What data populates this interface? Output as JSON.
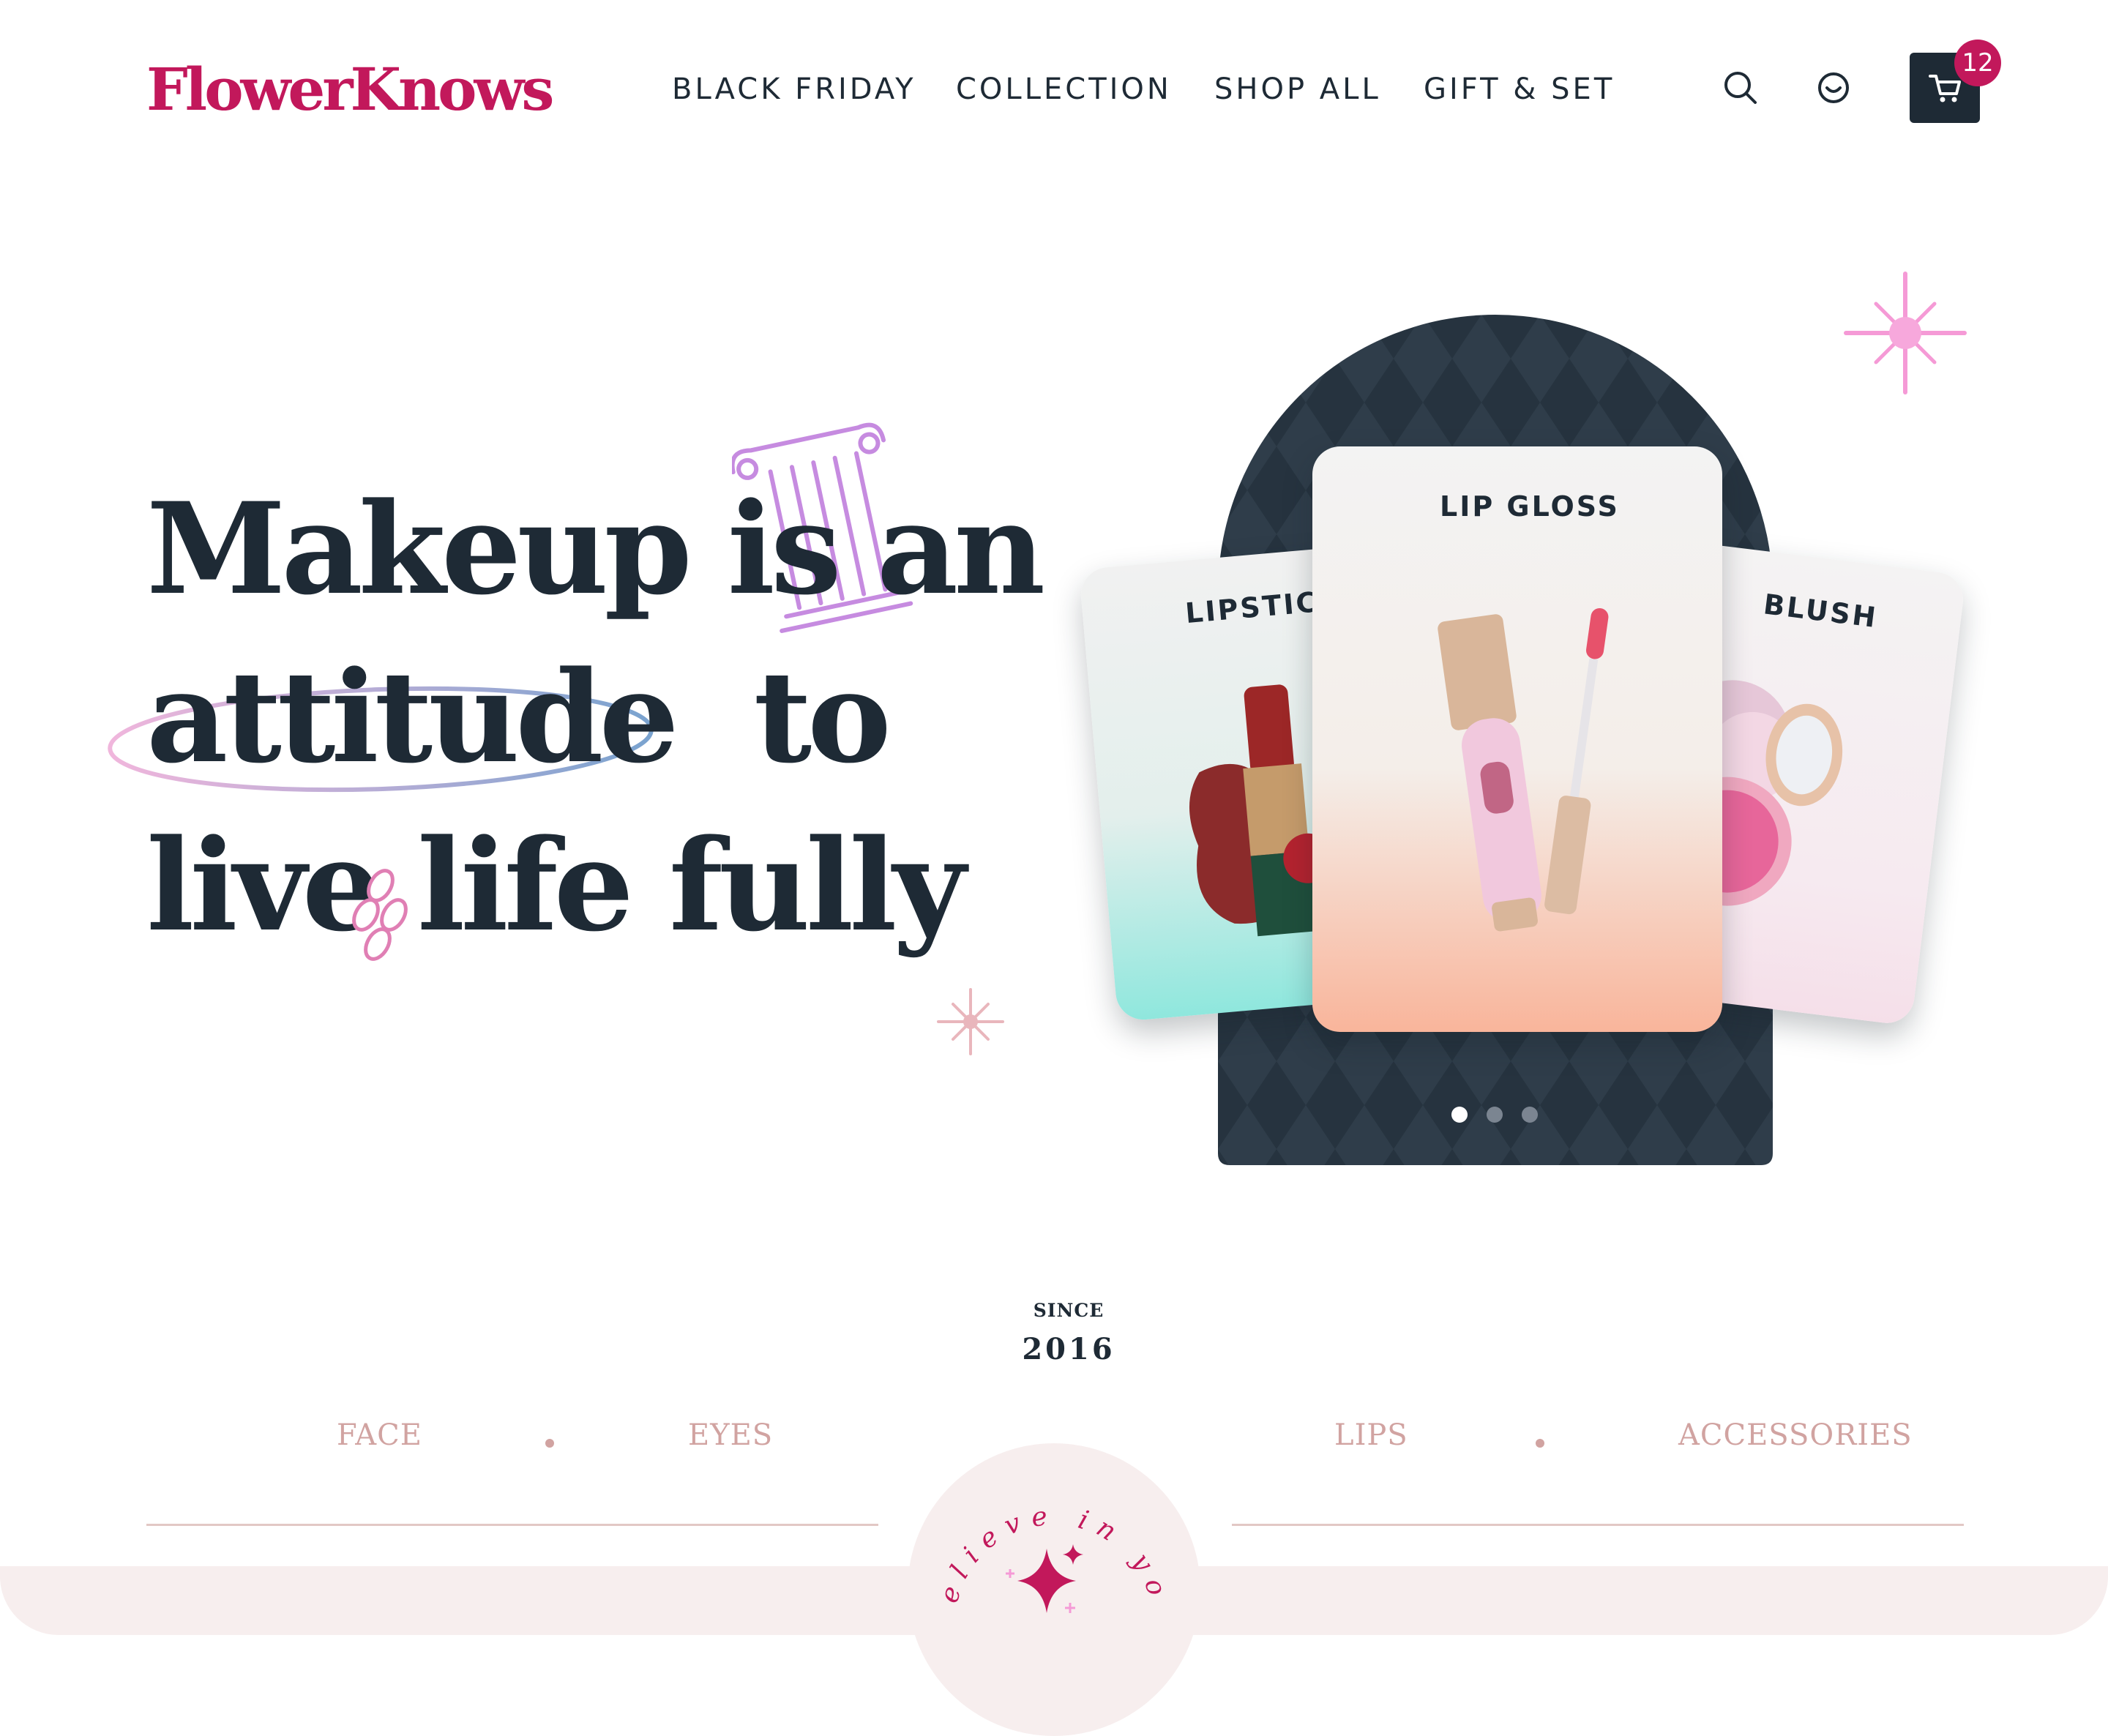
{
  "brand": {
    "name": "FlowerKnows"
  },
  "nav": {
    "items": [
      "BLACK FRIDAY",
      "COLLECTION",
      "SHOP ALL",
      "GIFT & SET"
    ]
  },
  "header_icons": {
    "search": "search-icon",
    "account": "smiley-face-icon",
    "cart": "cart-icon",
    "cart_count": "12"
  },
  "hero": {
    "line1": "Makeup is an",
    "line2": "attitude  to",
    "line3": "live life fully"
  },
  "carousel": {
    "cards": [
      {
        "label": "LIPSTICK"
      },
      {
        "label": "LIP GLOSS"
      },
      {
        "label": "BLUSH"
      }
    ],
    "active_index": 0,
    "dot_count": 3
  },
  "since": {
    "label": "SINCE",
    "year": "2016"
  },
  "categories": [
    "FACE",
    "EYES",
    "LIPS",
    "ACCESSORIES"
  ],
  "badge_text": "Believe in you",
  "colors": {
    "brand": "#c2185b",
    "dark": "#1e2a35",
    "arch": "#26333f",
    "category": "#d1a3a1",
    "footer_bg": "#f7eeee"
  }
}
